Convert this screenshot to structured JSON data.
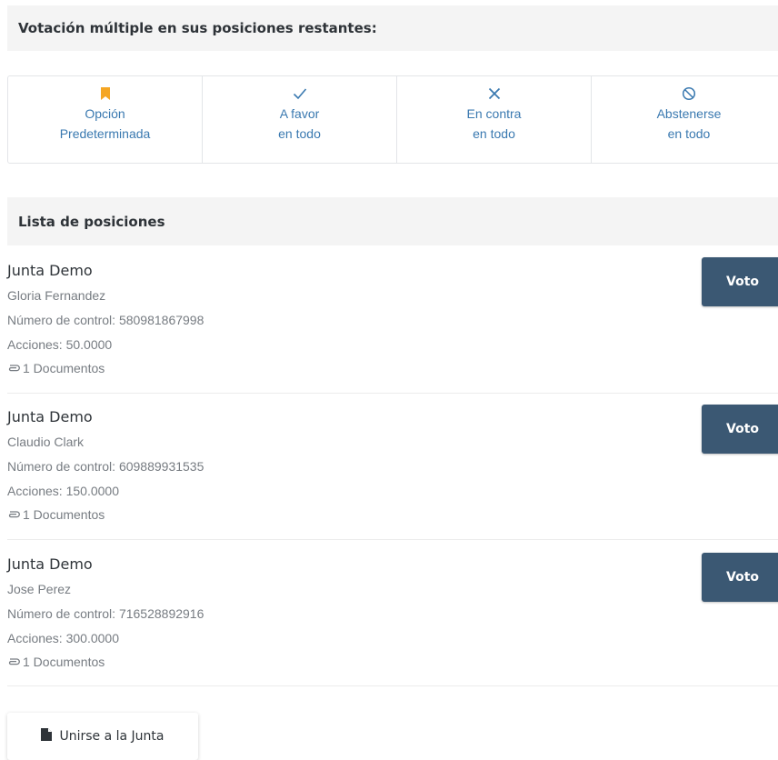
{
  "multi_vote": {
    "title": "Votación múltiple en sus posiciones restantes:",
    "options": [
      {
        "icon": "bookmark-icon",
        "line1": "Opción",
        "line2": "Predeterminada",
        "color": "#f5a623"
      },
      {
        "icon": "check-icon",
        "line1": "A favor",
        "line2": "en todo",
        "color": "#3a79b0"
      },
      {
        "icon": "x-icon",
        "line1": "En contra",
        "line2": "en todo",
        "color": "#3a79b0"
      },
      {
        "icon": "ban-icon",
        "line1": "Abstenerse",
        "line2": "en todo",
        "color": "#3a79b0"
      }
    ]
  },
  "positions_header": "Lista de posiciones",
  "positions": [
    {
      "title": "Junta Demo",
      "holder": "Gloria Fernandez",
      "control": "Número de control: 580981867998",
      "shares": "Acciones: 50.0000",
      "docs": "1 Documentos",
      "vote_label": "Voto"
    },
    {
      "title": "Junta Demo",
      "holder": "Claudio Clark",
      "control": "Número de control: 609889931535",
      "shares": "Acciones: 150.0000",
      "docs": "1 Documentos",
      "vote_label": "Voto"
    },
    {
      "title": "Junta Demo",
      "holder": "Jose Perez",
      "control": "Número de control: 716528892916",
      "shares": "Acciones: 300.0000",
      "docs": "1 Documentos",
      "vote_label": "Voto"
    }
  ],
  "join_button": {
    "label": "Unirse a la Junta",
    "icon": "file-icon"
  },
  "colors": {
    "accent": "#3a79b0",
    "button": "#3b5873",
    "bookmark": "#f5a623",
    "header_bg": "#f4f4f4"
  }
}
